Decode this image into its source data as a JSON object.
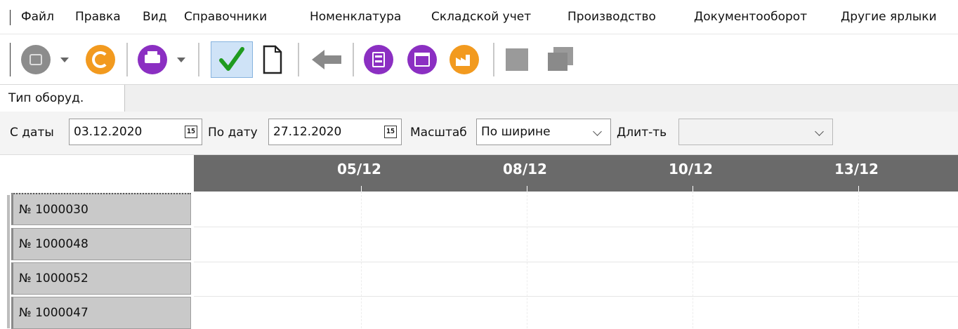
{
  "menu": [
    "Файл",
    "Правка",
    "Вид",
    "Справочники",
    "Номенклатура",
    "Складской учет",
    "Производство",
    "Документооборот",
    "Другие ярлыки"
  ],
  "toolbar": {
    "icons": [
      "record-icon",
      "refresh-icon",
      "print-icon",
      "check-icon",
      "new-document-icon",
      "back-arrow-icon",
      "calculator-icon",
      "calendar-icon",
      "factory-icon",
      "square-icon",
      "copy-icon"
    ],
    "colors": {
      "grey": "#8c8c8c",
      "orange": "#f29a1f",
      "purple": "#8b2fc2",
      "green": "#1f9b1f",
      "back": "#8a8a8a"
    }
  },
  "tab": {
    "label": "Тип оборуд."
  },
  "filter": {
    "from_label": "С даты",
    "from_value": "03.12.2020",
    "to_label": "По дату",
    "to_value": "27.12.2020",
    "scale_label": "Масштаб",
    "scale_value": "По ширине",
    "duration_label": "Длит-ть",
    "duration_value": ""
  },
  "timeline": {
    "dates": [
      "05/12",
      "08/12",
      "10/12",
      "13/12"
    ]
  },
  "rows": [
    "№ 1000030",
    "№ 1000048",
    "№ 1000052",
    "№ 1000047"
  ]
}
